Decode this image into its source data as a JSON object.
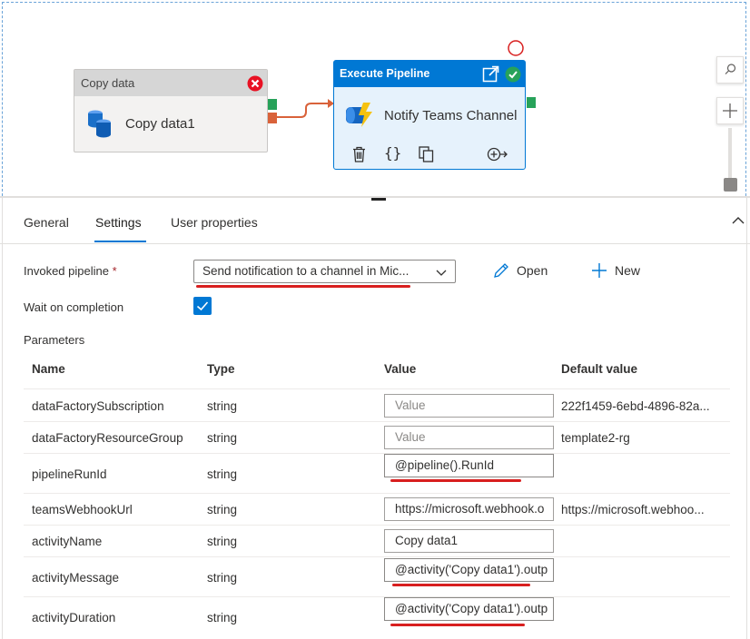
{
  "canvas": {
    "copy_activity": {
      "type_label": "Copy data",
      "name": "Copy data1"
    },
    "execute_activity": {
      "type_label": "Execute Pipeline",
      "name": "Notify Teams Channel"
    }
  },
  "tabs": [
    {
      "label": "General"
    },
    {
      "label": "Settings",
      "active": true
    },
    {
      "label": "User properties"
    }
  ],
  "settings": {
    "invoked_pipeline_label": "Invoked pipeline",
    "required_mark": "*",
    "invoked_pipeline_value": "Send notification to a channel in Mic...",
    "open_label": "Open",
    "new_label": "New",
    "wait_label": "Wait on completion",
    "wait_checked": true,
    "parameters_label": "Parameters"
  },
  "parameters": {
    "headers": {
      "name": "Name",
      "type": "Type",
      "value": "Value",
      "default": "Default value"
    },
    "rows": [
      {
        "name": "dataFactorySubscription",
        "type": "string",
        "value": "Value",
        "value_is_placeholder": true,
        "default": "222f1459-6ebd-4896-82a..."
      },
      {
        "name": "dataFactoryResourceGroup",
        "type": "string",
        "value": "Value",
        "value_is_placeholder": true,
        "default": "template2-rg"
      },
      {
        "name": "pipelineRunId",
        "type": "string",
        "value": "@pipeline().RunId",
        "value_is_placeholder": false,
        "default": ""
      },
      {
        "name": "teamsWebhookUrl",
        "type": "string",
        "value": "https://microsoft.webhook.o",
        "value_is_placeholder": false,
        "default": "https://microsoft.webhoo..."
      },
      {
        "name": "activityName",
        "type": "string",
        "value": "Copy data1",
        "value_is_placeholder": false,
        "default": ""
      },
      {
        "name": "activityMessage",
        "type": "string",
        "value": "@activity('Copy data1').outp",
        "value_is_placeholder": false,
        "default": ""
      },
      {
        "name": "activityDuration",
        "type": "string",
        "value": "@activity('Copy data1').outp",
        "value_is_placeholder": false,
        "default": ""
      }
    ]
  },
  "colors": {
    "accent": "#0078d4",
    "success_port": "#27a25a",
    "failure_port": "#d9623a",
    "error_icon": "#e81123",
    "annotation_red": "#d81f1f"
  },
  "icons": [
    "copy-data-icon",
    "error-icon",
    "external-link-icon",
    "success-check-icon",
    "execute-pipeline-icon",
    "delete-icon",
    "code-braces-icon",
    "clone-icon",
    "add-output-icon",
    "search-icon",
    "zoom-in-icon",
    "pencil-icon",
    "plus-icon",
    "chevron-down-icon",
    "chevron-up-icon",
    "checkmark-icon"
  ]
}
